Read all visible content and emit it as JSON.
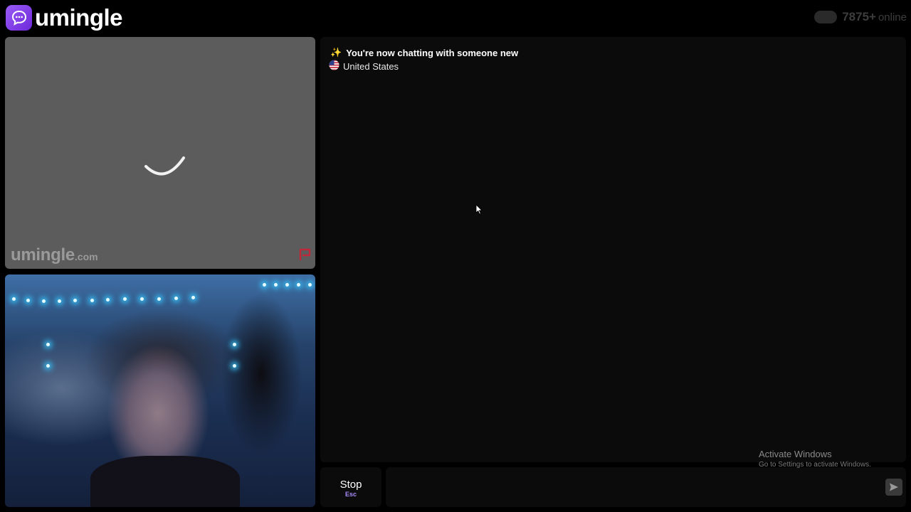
{
  "header": {
    "logo_text": "umingle",
    "online_count": "7875+",
    "online_label": "online"
  },
  "stranger_video": {
    "watermark_main": "umingle",
    "watermark_domain": ".com",
    "state": "loading"
  },
  "chat": {
    "system_message": "You're now chatting with someone new",
    "country": "United States"
  },
  "controls": {
    "stop_label": "Stop",
    "stop_shortcut": "Esc",
    "message_placeholder": ""
  },
  "os_watermark": {
    "title": "Activate Windows",
    "subtitle": "Go to Settings to activate Windows."
  },
  "colors": {
    "brand": "#8b5cf6",
    "shortcut": "#a78bfa",
    "report_icon": "#c0283a"
  }
}
